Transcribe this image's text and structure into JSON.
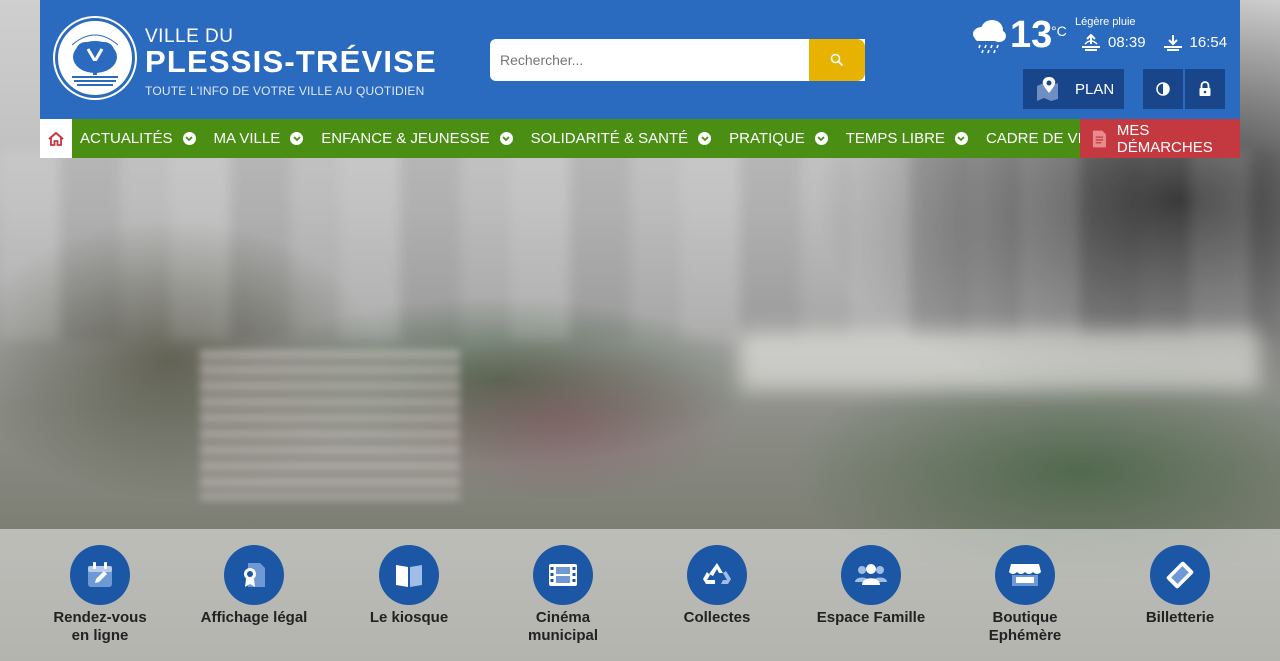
{
  "header": {
    "brand_small": "VILLE DU",
    "brand_big": "PLESSIS-TRÉVISE",
    "tagline": "TOUTE L'INFO DE VOTRE VILLE AU QUOTIDIEN",
    "logo_text": "Le Plessis-Trévise"
  },
  "search": {
    "placeholder": "Rechercher..."
  },
  "weather": {
    "temperature": "13",
    "unit": "°C",
    "description": "Légère pluie",
    "sunrise": "08:39",
    "sunset": "16:54",
    "icon": "cloud-rain-icon"
  },
  "toolbar": {
    "plan_label": "PLAN",
    "contrast_icon": "contrast-icon",
    "lock_icon": "lock-icon"
  },
  "nav": {
    "items": [
      {
        "label": "ACTUALITÉS"
      },
      {
        "label": "MA VILLE"
      },
      {
        "label": "ENFANCE & JEUNESSE"
      },
      {
        "label": "SOLIDARITÉ & SANTÉ"
      },
      {
        "label": "PRATIQUE"
      },
      {
        "label": "TEMPS LIBRE"
      },
      {
        "label": "CADRE DE VIE"
      }
    ],
    "demarches_label": "MES DÉMARCHES"
  },
  "quick_links": [
    {
      "label": "Rendez-vous\nen ligne",
      "icon": "calendar-edit-icon"
    },
    {
      "label": "Affichage légal",
      "icon": "certificate-document-icon"
    },
    {
      "label": "Le kiosque",
      "icon": "book-open-icon"
    },
    {
      "label": "Cinéma\nmunicipal",
      "icon": "film-icon"
    },
    {
      "label": "Collectes",
      "icon": "recycle-icon"
    },
    {
      "label": "Espace Famille",
      "icon": "family-icon"
    },
    {
      "label": "Boutique\nEphémère",
      "icon": "shop-icon"
    },
    {
      "label": "Billetterie",
      "icon": "ticket-icon"
    }
  ],
  "colors": {
    "header_blue": "#2a6abf",
    "nav_green": "#4a8e14",
    "demarches_red": "#c4393f",
    "search_yellow": "#e8b300",
    "quick_circle_blue": "#1c57a5"
  }
}
